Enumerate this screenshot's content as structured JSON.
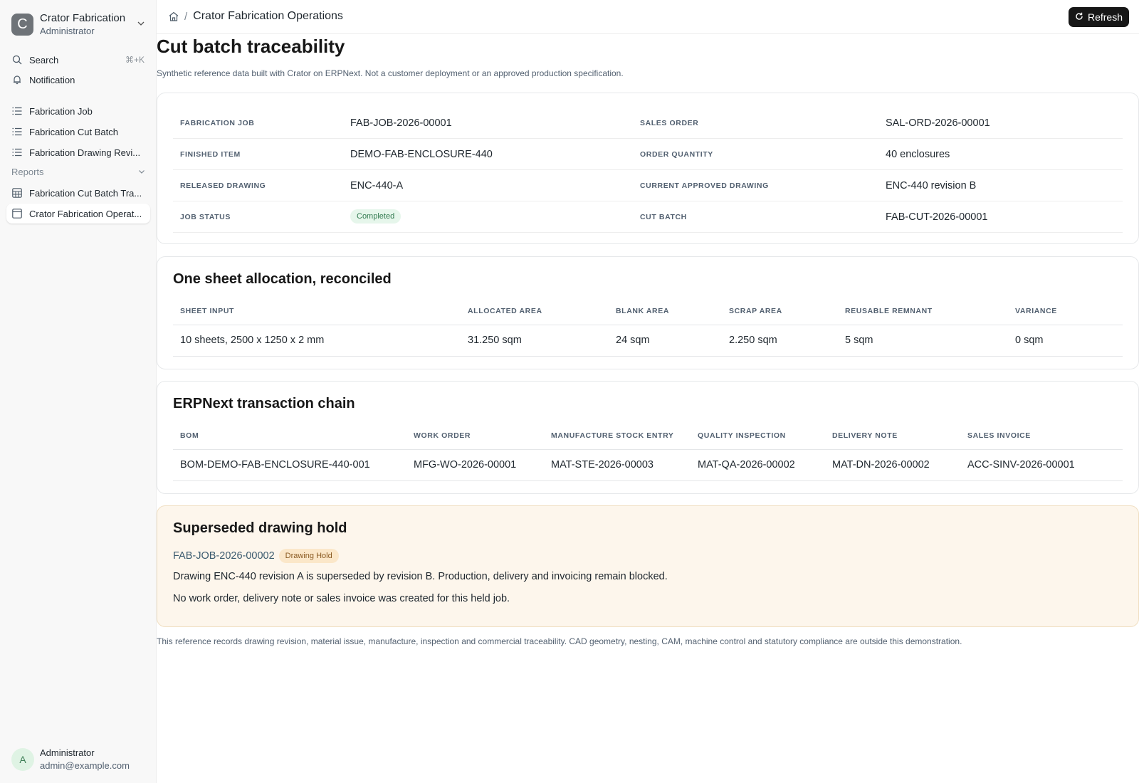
{
  "workspace": {
    "initial": "C",
    "name": "Crator Fabrication",
    "role": "Administrator"
  },
  "sidebar": {
    "search": {
      "label": "Search",
      "shortcut": "⌘+K"
    },
    "notification": {
      "label": "Notification"
    },
    "items": [
      {
        "label": "Fabrication Job",
        "icon": "list-icon"
      },
      {
        "label": "Fabrication Cut Batch",
        "icon": "list-icon"
      },
      {
        "label": "Fabrication Drawing Revi...",
        "icon": "list-icon"
      }
    ],
    "reports_label": "Reports",
    "report_items": [
      {
        "label": "Fabrication Cut Batch Tra...",
        "icon": "table-icon"
      },
      {
        "label": "Crator Fabrication Operat...",
        "icon": "page-icon",
        "active": true
      }
    ],
    "user": {
      "initial": "A",
      "name": "Administrator",
      "email": "admin@example.com"
    }
  },
  "header": {
    "breadcrumb": "Crator Fabrication Operations",
    "refresh_label": "Refresh"
  },
  "page": {
    "title": "Cut batch traceability",
    "subtitle": "Synthetic reference data built with Crator on ERPNext. Not a customer deployment or an approved production specification."
  },
  "summary": {
    "fabrication_job": {
      "label": "FABRICATION JOB",
      "value": "FAB-JOB-2026-00001"
    },
    "sales_order": {
      "label": "SALES ORDER",
      "value": "SAL-ORD-2026-00001"
    },
    "finished_item": {
      "label": "FINISHED ITEM",
      "value": "DEMO-FAB-ENCLOSURE-440"
    },
    "order_quantity": {
      "label": "ORDER QUANTITY",
      "value": "40 enclosures"
    },
    "released_drawing": {
      "label": "RELEASED DRAWING",
      "value": "ENC-440-A"
    },
    "current_drawing": {
      "label": "CURRENT APPROVED DRAWING",
      "value": "ENC-440 revision B"
    },
    "job_status": {
      "label": "JOB STATUS",
      "value": "Completed"
    },
    "cut_batch": {
      "label": "CUT BATCH",
      "value": "FAB-CUT-2026-00001"
    }
  },
  "allocation": {
    "title": "One sheet allocation, reconciled",
    "headers": [
      "SHEET INPUT",
      "ALLOCATED AREA",
      "BLANK AREA",
      "SCRAP AREA",
      "REUSABLE REMNANT",
      "VARIANCE"
    ],
    "row": [
      "10 sheets, 2500 x 1250 x 2 mm",
      "31.250 sqm",
      "24 sqm",
      "2.250 sqm",
      "5 sqm",
      "0 sqm"
    ]
  },
  "chain": {
    "title": "ERPNext transaction chain",
    "headers": [
      "BOM",
      "WORK ORDER",
      "MANUFACTURE STOCK ENTRY",
      "QUALITY INSPECTION",
      "DELIVERY NOTE",
      "SALES INVOICE"
    ],
    "row": [
      "BOM-DEMO-FAB-ENCLOSURE-440-001",
      "MFG-WO-2026-00001",
      "MAT-STE-2026-00003",
      "MAT-QA-2026-00002",
      "MAT-DN-2026-00002",
      "ACC-SINV-2026-00001"
    ]
  },
  "hold": {
    "title": "Superseded drawing hold",
    "job": "FAB-JOB-2026-00002",
    "badge": "Drawing Hold",
    "line1": "Drawing ENC-440 revision A is superseded by revision B. Production, delivery and invoicing remain blocked.",
    "line2": "No work order, delivery note or sales invoice was created for this held job."
  },
  "footnote": "This reference records drawing revision, material issue, manufacture, inspection and commercial traceability. CAD geometry, nesting, CAM, machine control and statutory compliance are outside this demonstration.",
  "colors": {
    "link": "#3a5a6e",
    "hold_bg": "#fdf6ec",
    "completed_bg": "#e6f6eb",
    "refresh_bg": "#171717"
  }
}
